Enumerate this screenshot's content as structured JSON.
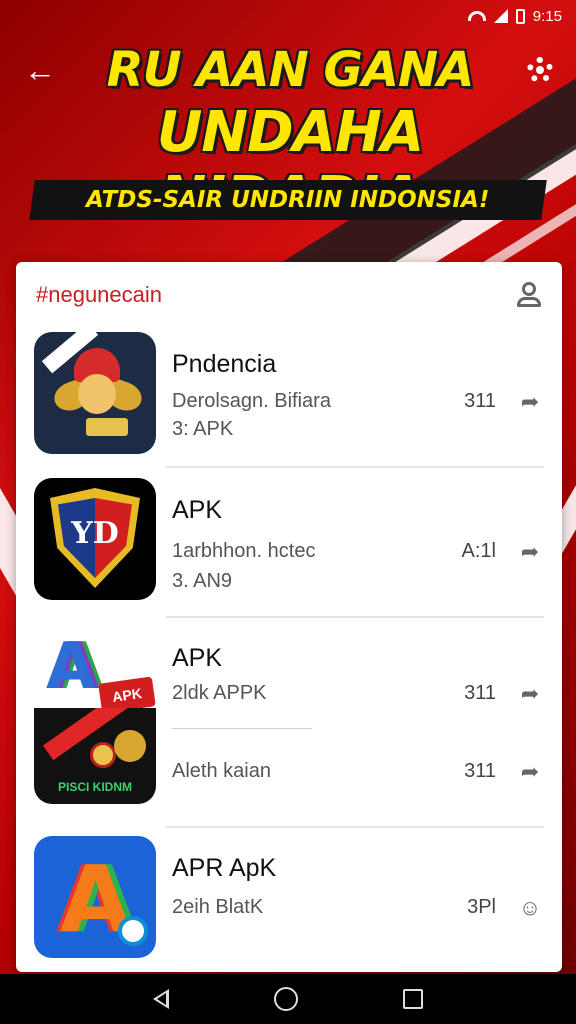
{
  "status_bar": {
    "time": "9:15"
  },
  "header": {
    "title_line1": "RU AAN GANA",
    "title_line2": "UNDAHA NIDADIA",
    "tagline": "ATDS-SAIR UNDRIIN INDONSIA!"
  },
  "list": {
    "title": "#negunecain",
    "items": [
      {
        "name": "Pndencia",
        "subtitle": "Derolsagn. Bifiara",
        "meta": "3: APK",
        "count": "311"
      },
      {
        "name": "APK",
        "subtitle": "1arbhhon. hctec",
        "meta": "3. AN9",
        "count": "A:1l"
      },
      {
        "name": "APK",
        "subtitle": "2ldk APPK",
        "meta": "",
        "count": "311"
      },
      {
        "name": "",
        "subtitle": "Aleth kaian",
        "meta": "",
        "count": "311"
      },
      {
        "name": "APR ApK",
        "subtitle": "2eih BlatK",
        "meta": "",
        "count": "3Pl"
      }
    ]
  },
  "icon_labels": {
    "badge": "APK",
    "cricket": "PISCI KIDNM"
  },
  "colors": {
    "background": "#d40e0e",
    "accent_yellow": "#ffe600",
    "list_title": "#c62020"
  },
  "icons": {
    "back": "arrow-left-icon",
    "settings": "gear-icon",
    "profile": "profile-icon",
    "share": "share-icon",
    "nav_back": "nav-back-icon",
    "nav_home": "nav-home-icon",
    "nav_recents": "nav-recents-icon"
  }
}
